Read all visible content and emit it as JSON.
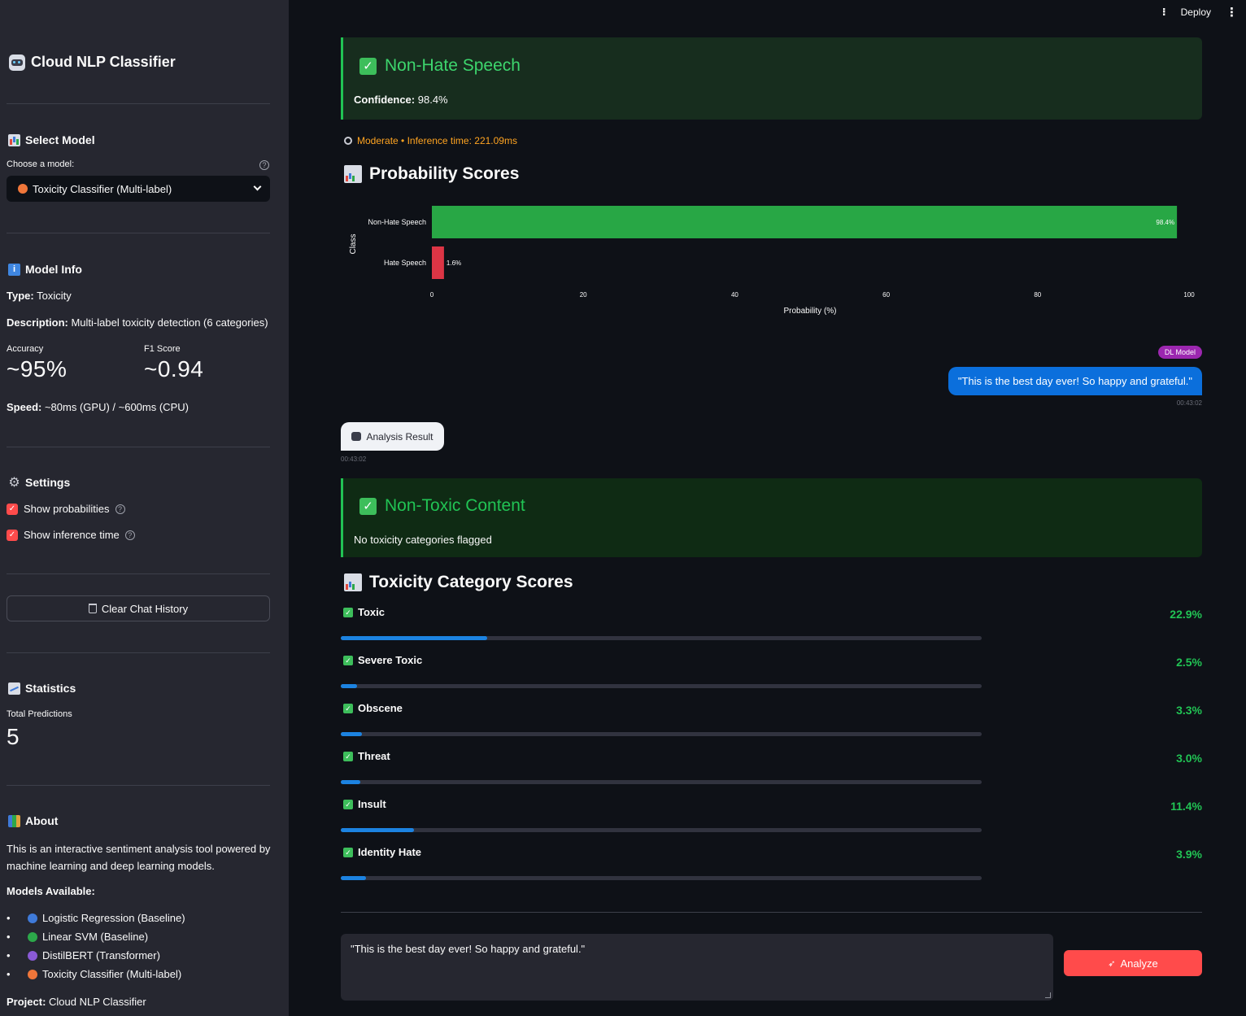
{
  "sidebar": {
    "app_title": "Cloud NLP Classifier",
    "select_model_heading": "Select Model",
    "choose_label": "Choose a model:",
    "selected_model": "Toxicity Classifier (Multi-label)",
    "model_info_heading": "Model Info",
    "type_label": "Type:",
    "type_value": "Toxicity",
    "desc_label": "Description:",
    "desc_value": "Multi-label toxicity detection (6 categories)",
    "accuracy_label": "Accuracy",
    "accuracy_value": "~95%",
    "f1_label": "F1 Score",
    "f1_value": "~0.94",
    "speed_label": "Speed:",
    "speed_value": "~80ms (GPU) / ~600ms (CPU)",
    "settings_heading": "Settings",
    "show_probabilities": "Show probabilities",
    "show_inference_time": "Show inference time",
    "clear_button": "Clear Chat History",
    "statistics_heading": "Statistics",
    "total_predictions_label": "Total Predictions",
    "total_predictions_value": "5",
    "about_heading": "About",
    "about_line1": "This is an interactive sentiment analysis tool powered by",
    "about_line2": "machine learning and deep learning models.",
    "models_available_label": "Models Available:",
    "models": [
      {
        "label": "Logistic Regression (Baseline)",
        "color": "#3f7ad9"
      },
      {
        "label": "Linear SVM (Baseline)",
        "color": "#2ca84a"
      },
      {
        "label": "DistilBERT (Transformer)",
        "color": "#8a5ad6"
      },
      {
        "label": "Toxicity Classifier (Multi-label)",
        "color": "#f0763a"
      }
    ],
    "project_label": "Project:",
    "project_value": "Cloud NLP Classifier"
  },
  "topbar": {
    "deploy": "Deploy"
  },
  "result1": {
    "title": "Non-Hate Speech",
    "confidence_label": "Confidence:",
    "confidence_value": "98.4%",
    "meta": "Moderate • Inference time: 221.09ms"
  },
  "prob_heading": "Probability Scores",
  "chart_data": {
    "type": "bar",
    "orientation": "horizontal",
    "categories": [
      "Non-Hate Speech",
      "Hate Speech"
    ],
    "values": [
      98.4,
      1.6
    ],
    "value_labels": [
      "98.4%",
      "1.6%"
    ],
    "colors": [
      "#28a745",
      "#dc3545"
    ],
    "xlabel": "Probability (%)",
    "ylabel": "Class",
    "xlim": [
      0,
      100
    ],
    "xticks": [
      "0",
      "20",
      "40",
      "60",
      "80",
      "100"
    ]
  },
  "chat": {
    "badge": "DL Model",
    "user_message": "\"This is the best day ever! So happy and grateful.\"",
    "user_time": "00:43:02",
    "bot_label": "Analysis Result",
    "bot_time": "00:43:02"
  },
  "result2": {
    "title": "Non-Toxic Content",
    "subtitle": "No toxicity categories flagged"
  },
  "tox_heading": "Toxicity Category Scores",
  "toxicity": [
    {
      "label": "Toxic",
      "value": 22.9,
      "text": "22.9%"
    },
    {
      "label": "Severe Toxic",
      "value": 2.5,
      "text": "2.5%"
    },
    {
      "label": "Obscene",
      "value": 3.3,
      "text": "3.3%"
    },
    {
      "label": "Threat",
      "value": 3.0,
      "text": "3.0%"
    },
    {
      "label": "Insult",
      "value": 11.4,
      "text": "11.4%"
    },
    {
      "label": "Identity Hate",
      "value": 3.9,
      "text": "3.9%"
    }
  ],
  "input": {
    "value": "\"This is the best day ever! So happy and grateful.\"",
    "analyze_button": "Analyze"
  },
  "colors": {
    "accent": "#ff4b4b",
    "success": "#21c354",
    "progress": "#1c83e1",
    "warning": "#ffa421"
  }
}
